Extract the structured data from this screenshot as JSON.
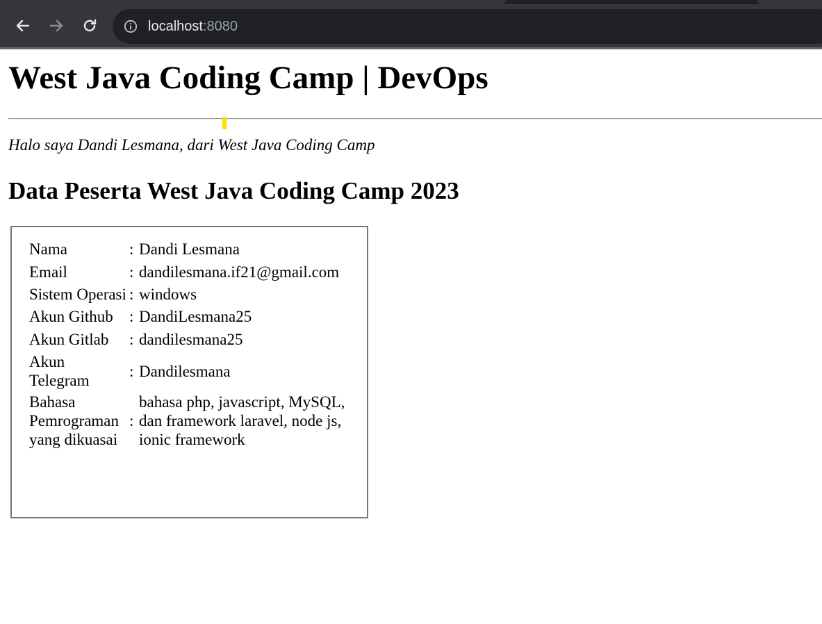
{
  "browser": {
    "url_host": "localhost",
    "url_port": ":8080"
  },
  "page": {
    "title": "West Java Coding Camp | DevOps",
    "intro": "Halo saya Dandi Lesmana, dari West Java Coding Camp",
    "subtitle": "Data Peserta West Java Coding Camp 2023",
    "rows": [
      {
        "label": "Nama",
        "sep": ":",
        "value": "Dandi Lesmana"
      },
      {
        "label": "Email",
        "sep": ":",
        "value": "dandilesmana.if21@gmail.com"
      },
      {
        "label": "Sistem Operasi",
        "sep": ":",
        "value": "windows"
      },
      {
        "label": "Akun Github",
        "sep": ":",
        "value": "DandiLesmana25"
      },
      {
        "label": "Akun Gitlab",
        "sep": ":",
        "value": "dandilesmana25"
      },
      {
        "label": "Akun Telegram",
        "sep": ":",
        "value": "Dandilesmana"
      },
      {
        "label": "Bahasa Pemrograman yang dikuasai",
        "sep": ":",
        "value": "bahasa php, javascript, MySQL, dan framework laravel, node js, ionic framework"
      }
    ]
  },
  "icons": {
    "back": "arrow-left-icon",
    "forward": "arrow-right-icon",
    "reload": "reload-icon",
    "info": "info-icon"
  }
}
